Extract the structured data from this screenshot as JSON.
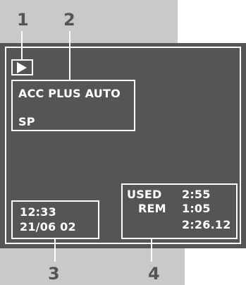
{
  "callouts": [
    "1",
    "2",
    "3",
    "4"
  ],
  "display": {
    "play_indicator": "play-icon",
    "mode_box": {
      "line1": "ACC PLUS AUTO",
      "line2": "SP"
    },
    "time_date_box": {
      "time": "12:33",
      "date": "21/06 02"
    },
    "tape_box": {
      "used_label": "USED",
      "used_value": "2:55",
      "rem_label": "REM",
      "rem_value": "1:05",
      "counter": "2:26.12"
    }
  },
  "colors": {
    "screen_background": "#555555",
    "band_background": "#c9c9c9",
    "display_text": "#ffffff",
    "callout_text": "#555555"
  }
}
